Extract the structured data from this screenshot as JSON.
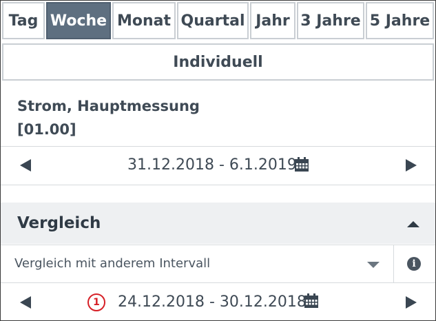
{
  "tabs": [
    {
      "label": "Tag",
      "active": false
    },
    {
      "label": "Woche",
      "active": true
    },
    {
      "label": "Monat",
      "active": false
    },
    {
      "label": "Quartal",
      "active": false
    },
    {
      "label": "Jahr",
      "active": false
    },
    {
      "label": "3 Jahre",
      "active": false
    },
    {
      "label": "5 Jahre",
      "active": false
    }
  ],
  "individual_label": "Individuell",
  "meter": {
    "name": "Strom, Hauptmessung",
    "id": "[01.00]"
  },
  "period": {
    "range": "31.12.2018 - 6.1.2019"
  },
  "comparison": {
    "title": "Vergleich",
    "select_value": "Vergleich mit anderem Intervall",
    "range": "24.12.2018 - 30.12.2018",
    "marker_number": "1"
  },
  "colors": {
    "active_tab": "#5e6f80",
    "marker": "#d61f26",
    "section_bg": "#eef0f2"
  }
}
